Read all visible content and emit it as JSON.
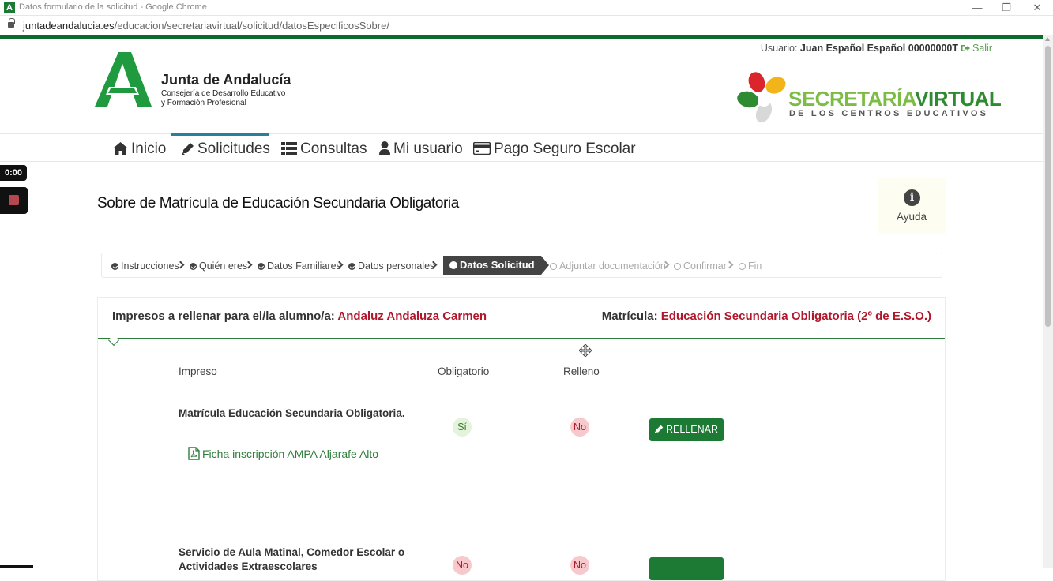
{
  "window": {
    "app_icon": "A",
    "title": "Datos formulario de la solicitud - Google Chrome",
    "minimize": "—",
    "restore": "❐",
    "close": "✕"
  },
  "browser": {
    "url_host": "juntadeandalucia.es",
    "url_path": "/educacion/secretariavirtual/solicitud/datosEspecificosSobre/"
  },
  "header": {
    "user_label": "Usuario:",
    "user_name": "Juan Español Español 00000000T",
    "logout": "Salir",
    "org_name": "Junta de Andalucía",
    "org_sub1": "Consejería de Desarrollo Educativo",
    "org_sub2": "y Formación Profesional",
    "sv_title_a": "SECRETARÍA",
    "sv_title_b": "VIRTUAL",
    "sv_sub": "DE LOS CENTROS EDUCATIVOS",
    "accent": "#0b6b2b"
  },
  "nav": {
    "items": [
      {
        "label": "Inicio",
        "icon": "home-icon"
      },
      {
        "label": "Solicitudes",
        "icon": "pencil-icon",
        "active": true
      },
      {
        "label": "Consultas",
        "icon": "list-icon"
      },
      {
        "label": "Mi usuario",
        "icon": "user-icon"
      },
      {
        "label": "Pago Seguro Escolar",
        "icon": "credit-card-icon"
      }
    ]
  },
  "recorder": {
    "time": "0:00"
  },
  "page": {
    "title": "Sobre de Matrícula de Educación Secundaria Obligatoria",
    "help": "Ayuda"
  },
  "steps": {
    "items": [
      {
        "label": "Instrucciones",
        "state": "done"
      },
      {
        "label": "Quién eres",
        "state": "done"
      },
      {
        "label": "Datos Familiares",
        "state": "done"
      },
      {
        "label": "Datos personales",
        "state": "done"
      },
      {
        "label": "Datos Solicitud",
        "state": "active"
      },
      {
        "label": "Adjuntar documentación",
        "state": "todo"
      },
      {
        "label": "Confirmar",
        "state": "todo"
      },
      {
        "label": "Fin",
        "state": "todo"
      }
    ]
  },
  "panel": {
    "student_label": "Impresos a rellenar para el/la alumno/a:",
    "student_name": "Andaluz Andaluza Carmen",
    "enrol_label": "Matrícula:",
    "enrol_value": "Educación Secundaria Obligatoria (2º de E.S.O.)",
    "columns": [
      "Impreso",
      "Obligatorio",
      "Relleno"
    ],
    "rows": [
      {
        "title": "Matrícula Educación Secundaria Obligatoria.",
        "obligatorio": "Sí",
        "relleno": "No",
        "action": "RELLENAR",
        "link": "Ficha inscripción AMPA Aljarafe Alto"
      },
      {
        "title_line1": "Servicio de Aula Matinal, Comedor Escolar o",
        "title_line2": "Actividades Extraescolares",
        "obligatorio": "No",
        "relleno": "No"
      }
    ]
  }
}
